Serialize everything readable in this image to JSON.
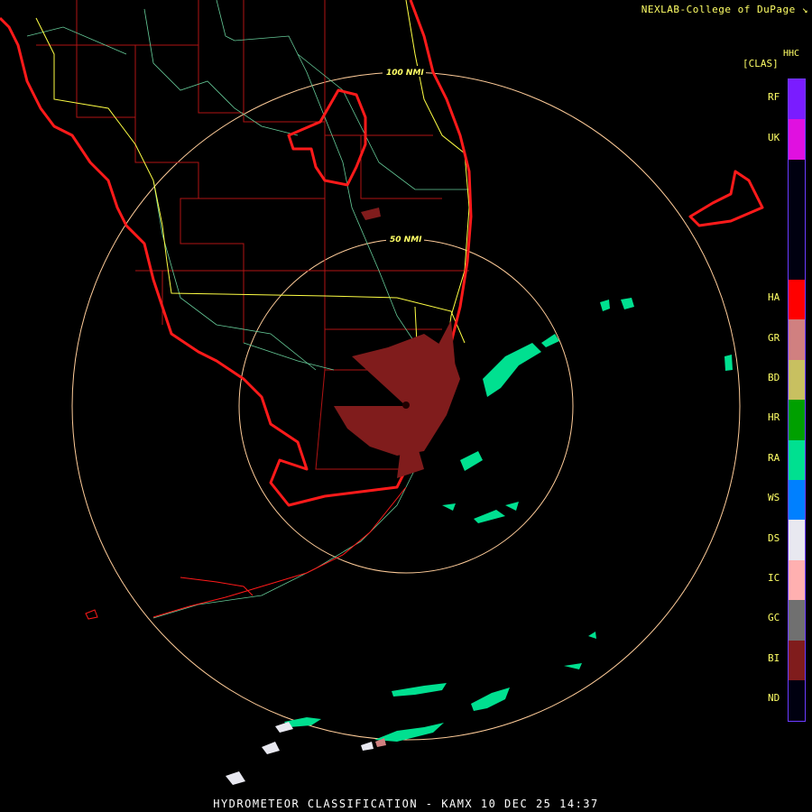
{
  "header": {
    "credit": "NEXLAB-College of DuPage",
    "product_code": "HHC",
    "class_label": "[CLAS]"
  },
  "footer": {
    "title": "HYDROMETEOR CLASSIFICATION - KAMX 10 DEC 25 14:37"
  },
  "rings": {
    "outer_label": "100 NMI",
    "inner_label": "50 NMI"
  },
  "legend": [
    {
      "code": "RF",
      "color": "#7a1cff"
    },
    {
      "code": "UK",
      "color": "#e010e0"
    },
    {
      "code": "",
      "color": "#000010"
    },
    {
      "code": "",
      "color": "#000010"
    },
    {
      "code": "",
      "color": "#000010"
    },
    {
      "code": "HA",
      "color": "#ff0000"
    },
    {
      "code": "GR",
      "color": "#d08080"
    },
    {
      "code": "BD",
      "color": "#c8c060"
    },
    {
      "code": "HR",
      "color": "#00a000"
    },
    {
      "code": "RA",
      "color": "#00e090"
    },
    {
      "code": "WS",
      "color": "#0080ff"
    },
    {
      "code": "DS",
      "color": "#e8e8f0"
    },
    {
      "code": "IC",
      "color": "#ffb0b0"
    },
    {
      "code": "GC",
      "color": "#707070"
    },
    {
      "code": "BI",
      "color": "#801c1c"
    },
    {
      "code": "ND",
      "color": "#000010"
    }
  ],
  "colors": {
    "coast": "#ff1a1a",
    "county": "#b01414",
    "highway": "#ffff44",
    "road": "#66cc99",
    "ring": "#ffcc99",
    "rain": "#00e090",
    "biological": "#801c1c"
  }
}
